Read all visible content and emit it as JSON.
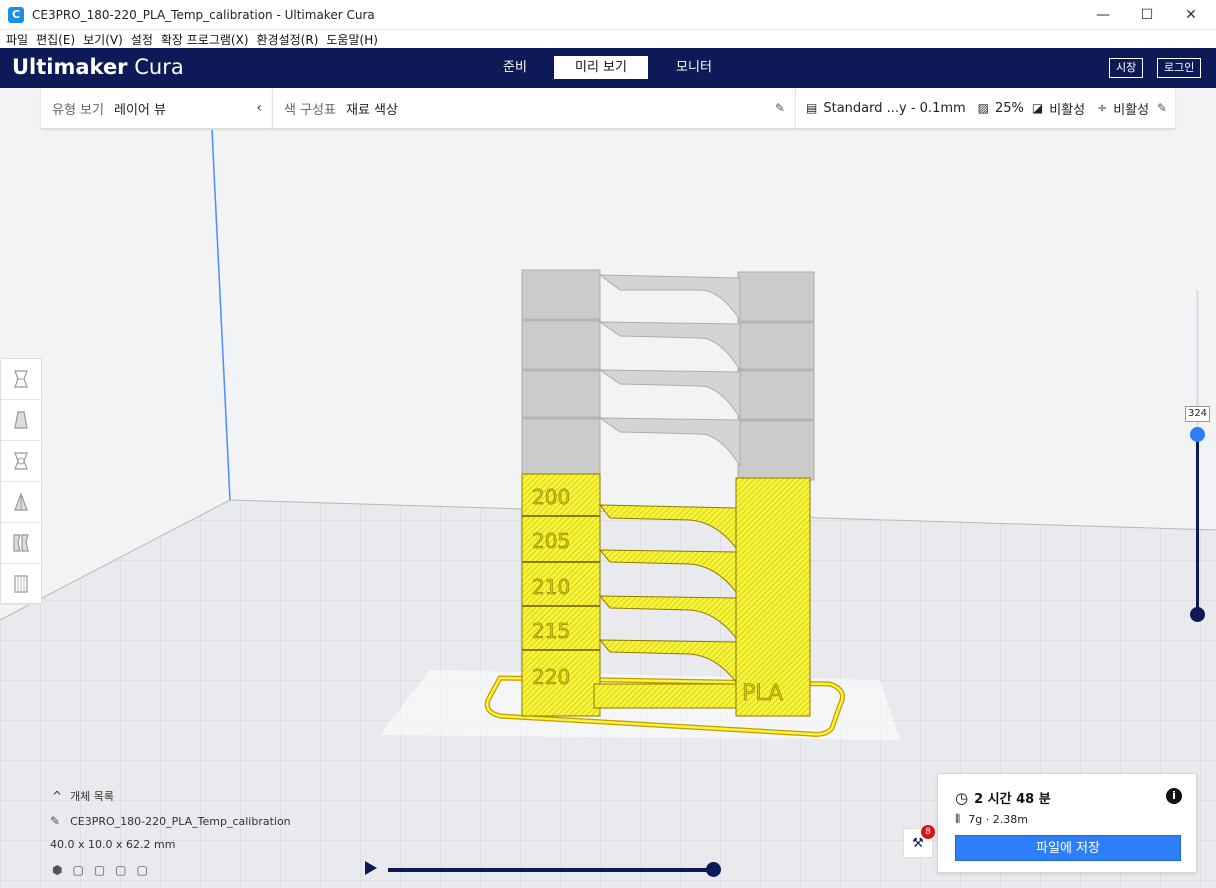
{
  "window": {
    "title": "CE3PRO_180-220_PLA_Temp_calibration - Ultimaker Cura",
    "app_icon": "C",
    "minimize": "—",
    "maximize": "☐",
    "close": "✕"
  },
  "menu": [
    "파일",
    "편집(E)",
    "보기(V)",
    "설정",
    "확장 프로그램(X)",
    "환경설정(R)",
    "도움말(H)"
  ],
  "header": {
    "brand_bold": "Ultimaker",
    "brand_light": "Cura",
    "tabs": [
      {
        "label": "준비",
        "active": false
      },
      {
        "label": "미리 보기",
        "active": true
      },
      {
        "label": "모니터",
        "active": false
      }
    ],
    "marketplace": "시장",
    "login": "로그인"
  },
  "view_panel": {
    "view_type_label": "유형 보기",
    "view_type_value": "레이어 뷰",
    "color_scheme_label": "색 구성표",
    "color_scheme_value": "재료 색상"
  },
  "print_settings": {
    "profile": "Standard ...y - 0.1mm",
    "infill": "25%",
    "support": "비활성",
    "adhesion": "비활성"
  },
  "model_labels": [
    "200",
    "205",
    "210",
    "215",
    "220",
    "PLA"
  ],
  "layer_slider": {
    "current_layer": "324"
  },
  "object_list": {
    "title": "개체 목록",
    "name": "CE3PRO_180-220_PLA_Temp_calibration",
    "dimensions": "40.0 x 10.0 x 62.2 mm"
  },
  "print_info": {
    "time": "2 시간 48 분",
    "material": "7g · 2.38m",
    "save_button": "파일에 저장"
  },
  "notifications": {
    "count": "8"
  },
  "colors": {
    "header_bg": "#0e1a57",
    "accent": "#2d7ff9",
    "model_yellow": "#f5f53a",
    "model_grey": "#c8c8c8"
  }
}
